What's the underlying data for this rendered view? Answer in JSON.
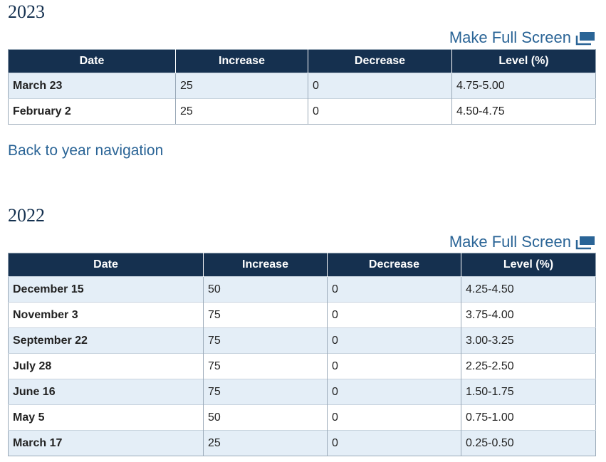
{
  "section_2023": {
    "year": "2023",
    "fullscreen_label": "Make Full Screen",
    "columns": [
      "Date",
      "Increase",
      "Decrease",
      "Level (%)"
    ],
    "rows": [
      {
        "date": "March 23",
        "increase": "25",
        "decrease": "0",
        "level": "4.75-5.00"
      },
      {
        "date": "February 2",
        "increase": "25",
        "decrease": "0",
        "level": "4.50-4.75"
      }
    ]
  },
  "back_link": "Back to year navigation",
  "section_2022": {
    "year": "2022",
    "fullscreen_label": "Make Full Screen",
    "columns": [
      "Date",
      "Increase",
      "Decrease",
      "Level (%)"
    ],
    "rows": [
      {
        "date": "December 15",
        "increase": "50",
        "decrease": "0",
        "level": "4.25-4.50"
      },
      {
        "date": "November 3",
        "increase": "75",
        "decrease": "0",
        "level": "3.75-4.00"
      },
      {
        "date": "September 22",
        "increase": "75",
        "decrease": "0",
        "level": "3.00-3.25"
      },
      {
        "date": "July 28",
        "increase": "75",
        "decrease": "0",
        "level": "2.25-2.50"
      },
      {
        "date": "June 16",
        "increase": "75",
        "decrease": "0",
        "level": "1.50-1.75"
      },
      {
        "date": "May 5",
        "increase": "50",
        "decrease": "0",
        "level": "0.75-1.00"
      },
      {
        "date": "March 17",
        "increase": "25",
        "decrease": "0",
        "level": "0.25-0.50"
      }
    ]
  },
  "colors": {
    "header_bg": "#15304f",
    "row_shaded": "#e4eef7",
    "link": "#2a6496",
    "year_title": "#14304f"
  },
  "icons": {
    "fullscreen": "fullscreen-icon"
  }
}
